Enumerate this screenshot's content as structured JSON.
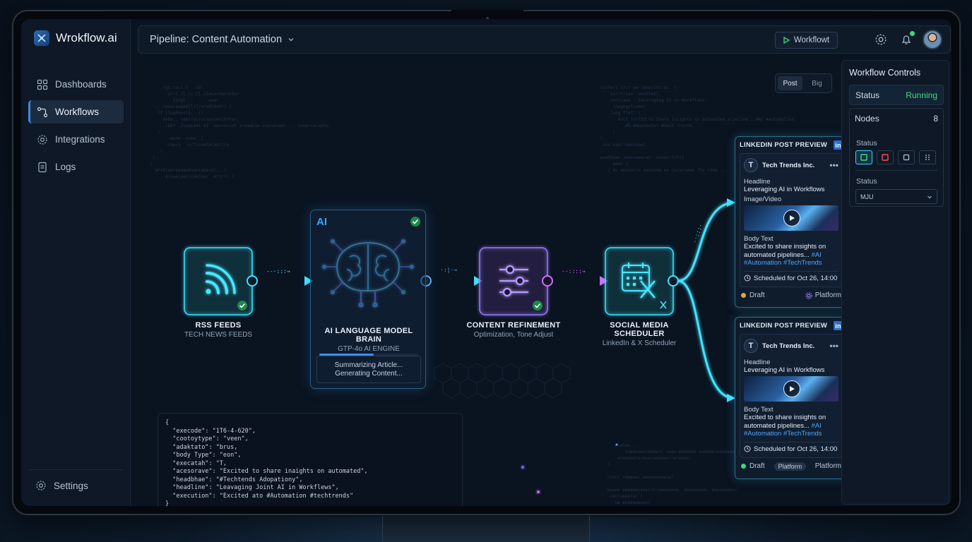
{
  "brand": {
    "name": "Wrokflow.ai"
  },
  "sidebar": {
    "items": [
      {
        "label": "Dashboards",
        "icon": "grid-icon"
      },
      {
        "label": "Workflows",
        "icon": "workflow-icon",
        "active": true
      },
      {
        "label": "Integrations",
        "icon": "gear-icon"
      },
      {
        "label": "Logs",
        "icon": "document-icon"
      }
    ],
    "settings_label": "Settings"
  },
  "topbar": {
    "pipeline_label": "Pipeline: Content Automation",
    "run_button_label": "Workflowt"
  },
  "view_toggle": {
    "post": "Post",
    "big": "Big"
  },
  "nodes": {
    "rss": {
      "title": "RSS FEEDS",
      "subtitle": "TECH NEWS FEEDS"
    },
    "ai": {
      "tag": "AI",
      "title": "AI LANGUAGE MODEL BRAIN",
      "subtitle": "GTP-4o AI ENGINE",
      "status_line1": "Summarizing Article...",
      "status_line2": "Generating Content...",
      "progress": 0.55
    },
    "refine": {
      "title": "CONTENT REFINEMENT",
      "subtitle": "Optimization, Tone Adjust"
    },
    "scheduler": {
      "title_line1": "SOCIAL MEDIA",
      "title_line2": "SCHEDULER",
      "subtitle": "LinkedIn & X Scheduler"
    }
  },
  "json_panel": {
    "open": "{",
    "lines": [
      {
        "key": "\"execode\"",
        "value": "\"1T6-4-620\","
      },
      {
        "key": "\"cootoytype\"",
        "value": "\"veen\","
      },
      {
        "key": "\"adaktato\"",
        "value": "\"brus,"
      },
      {
        "key": "\"body Type\"",
        "value": "\"eon\","
      },
      {
        "key": "\"execatah\"",
        "value": "\"T,"
      },
      {
        "key": "\"acesorave\"",
        "value": "\"Excited to share inaights on automated\","
      },
      {
        "key": "\"headbhae\"",
        "value": "\"#Techtends Adopationy\","
      },
      {
        "key": "\"headline\"",
        "value": "\"Leavaging Joint AI in Workflews\","
      },
      {
        "key": "\"execution\"",
        "value": "\"Excited ato #Automation #techtrends\""
      }
    ],
    "close": "}"
  },
  "preview_cards": [
    {
      "header": "LINKEDIN POST PREVIEW",
      "company": "Tech Trends Inc.",
      "headline_label": "Headline",
      "headline": "Leveraging AI in Workflows",
      "media_label": "Image/Video",
      "body_label": "Body Text",
      "body_line1": "Excited to share insights on",
      "body_line2": "automated pipelines...",
      "tag1": "#AI",
      "tags_line": "#Automation #TechTrends",
      "schedule": "Scheduled for Oct 26, 14:00",
      "status": "Draft",
      "status_color": "#e3a63a",
      "platform": "Platform"
    },
    {
      "header": "LINKEDIN POST PREVIEW",
      "company": "Tech Trends Inc.",
      "headline_label": "Headline",
      "headline": "Leveraging AI in Workflows",
      "body_label": "Body Text",
      "body_line1": "Excited to share insights on",
      "body_line2": "automated pipelines...",
      "tag1": "#AI",
      "tags_line": "#Automation #TechTrends",
      "schedule": "Scheduled for Oct 26, 14:00",
      "status": "Draft",
      "status_color": "#3fd77a",
      "pill": "Platform",
      "platform": "Platform"
    }
  ],
  "controls": {
    "title": "Workflow Controls",
    "status_label": "Status",
    "status_value": "Running",
    "nodes_label": "Nodes",
    "nodes_value": "8",
    "status2_label": "Status",
    "status3_label": "Status",
    "select_value": "MJU"
  },
  "colors": {
    "accent": "#3a8be0",
    "cyan": "#3fe3ff",
    "violet": "#b46bff",
    "success": "#3fd77a"
  }
}
